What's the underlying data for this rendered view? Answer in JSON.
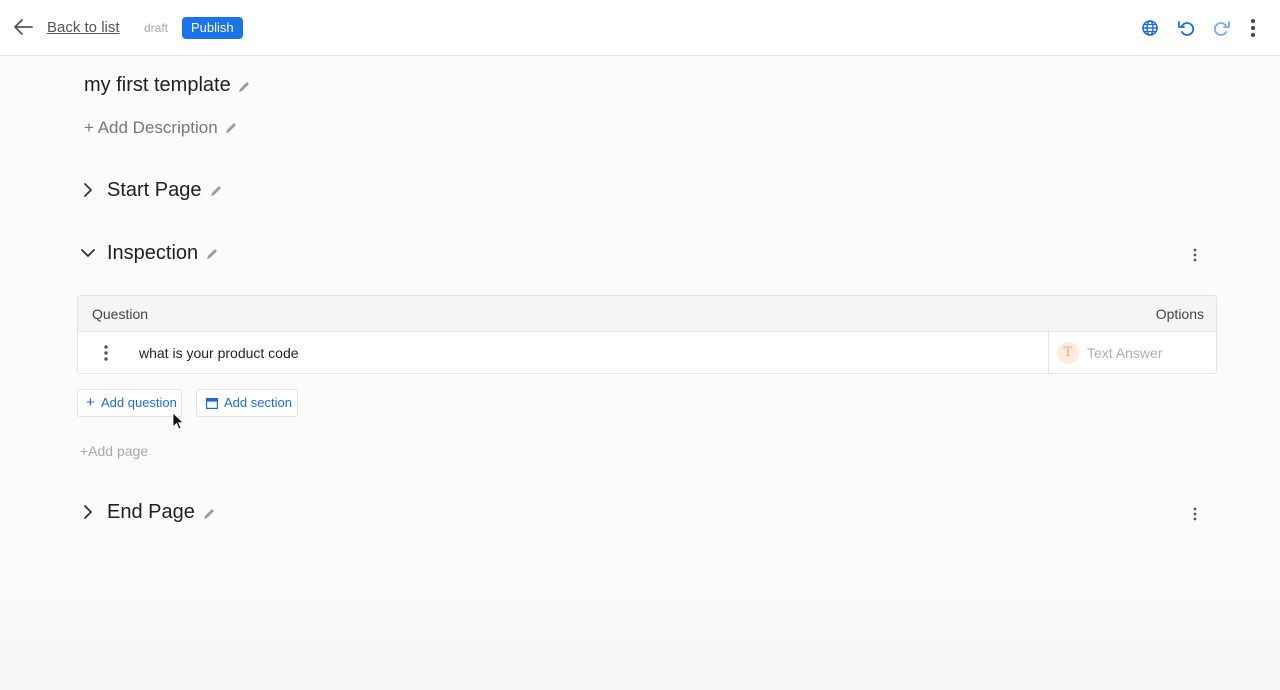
{
  "topbar": {
    "back_label": "Back to list",
    "status": "draft",
    "publish_label": "Publish",
    "icons": [
      "globe-icon",
      "undo-icon",
      "redo-icon",
      "more-vertical-icon"
    ],
    "accent_color": "#1a73e8"
  },
  "template": {
    "title": "my first template",
    "add_description": "+ Add Description"
  },
  "sections": {
    "start_page": "Start Page",
    "inspection": "Inspection",
    "end_page": "End Page"
  },
  "table": {
    "header_question": "Question",
    "header_options": "Options",
    "rows": [
      {
        "question": "what is your product code",
        "answer_type": "Text Answer",
        "type_badge": "T"
      }
    ]
  },
  "actions": {
    "add_question": "Add question",
    "add_section": "Add section",
    "add_page": "+Add page"
  }
}
